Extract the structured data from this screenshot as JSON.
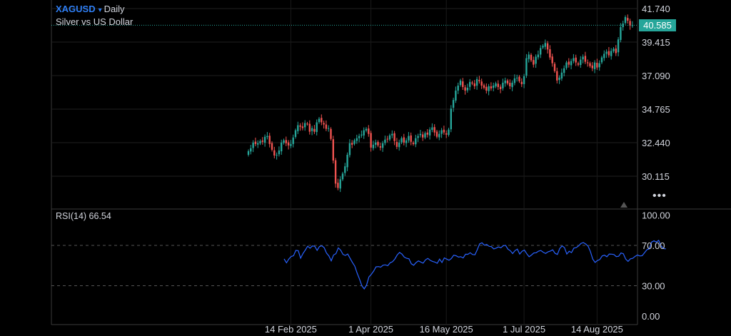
{
  "header": {
    "symbol": "XAGUSD",
    "caret": "▾",
    "timeframe": "Daily",
    "description": "Silver vs US Dollar",
    "last_price": "40.585"
  },
  "rsi_label": "RSI(14) 66.54",
  "colors": {
    "up": "#26a69a",
    "down": "#ef5350",
    "rsi": "#2962ff",
    "background": "#000000",
    "grid": "#1f1f1f"
  },
  "chart_data": [
    {
      "type": "candlestick",
      "title": "XAGUSD Daily",
      "ylim": [
        28.6,
        42.3
      ],
      "y_ticks": [
        "41.740",
        "39.415",
        "37.090",
        "34.765",
        "32.440",
        "30.115"
      ],
      "x_ticks": [
        "14 Feb 2025",
        "1 Apr 2025",
        "16 May 2025",
        "1 Jul 2025",
        "14 Aug 2025"
      ],
      "x_tick_index": [
        18,
        52,
        84,
        117,
        148
      ],
      "last_price": 40.585,
      "close": [
        31.85,
        32.05,
        32.45,
        32.35,
        32.4,
        32.55,
        32.5,
        32.85,
        32.9,
        32.35,
        31.95,
        31.55,
        31.6,
        31.9,
        32.45,
        32.6,
        32.4,
        32.25,
        32.35,
        32.8,
        33.3,
        33.65,
        33.55,
        33.45,
        33.8,
        33.75,
        33.2,
        33.45,
        33.2,
        33.85,
        34.1,
        33.85,
        33.7,
        33.4,
        33.45,
        32.7,
        31.2,
        29.6,
        29.3,
        29.9,
        30.3,
        30.8,
        31.6,
        32.4,
        32.3,
        32.6,
        32.75,
        32.9,
        33.0,
        33.3,
        33.4,
        33.05,
        32.1,
        32.3,
        32.45,
        32.25,
        32.1,
        32.4,
        32.65,
        32.7,
        32.95,
        33.05,
        32.55,
        32.15,
        32.45,
        32.75,
        32.45,
        32.6,
        32.9,
        32.5,
        32.35,
        32.75,
        32.9,
        33.05,
        32.8,
        33.1,
        33.0,
        33.35,
        33.5,
        33.15,
        32.85,
        33.05,
        33.3,
        33.15,
        33.0,
        33.35,
        34.8,
        35.4,
        36.05,
        36.4,
        36.75,
        36.3,
        36.05,
        36.25,
        36.65,
        36.55,
        36.35,
        36.85,
        36.7,
        36.4,
        36.25,
        36.05,
        36.35,
        36.2,
        36.4,
        36.55,
        36.3,
        36.15,
        36.6,
        36.75,
        36.55,
        36.35,
        36.6,
        36.9,
        36.95,
        36.7,
        36.5,
        37.05,
        38.3,
        38.55,
        38.15,
        37.85,
        38.4,
        38.55,
        39.0,
        39.15,
        39.35,
        38.9,
        38.35,
        37.95,
        37.4,
        36.75,
        36.95,
        37.3,
        37.6,
        38.0,
        37.85,
        38.1,
        38.3,
        38.0,
        37.85,
        38.2,
        38.4,
        38.05,
        37.95,
        37.75,
        37.6,
        38.0,
        37.65,
        37.95,
        38.35,
        38.6,
        38.75,
        38.5,
        38.8,
        38.95,
        38.65,
        39.6,
        40.45,
        40.7,
        41.15,
        40.9,
        40.55,
        40.585
      ],
      "y_range_note": "",
      "xlabel": "",
      "ylabel": ""
    },
    {
      "type": "line",
      "title": "RSI(14)",
      "series": [
        {
          "name": "RSI(14)",
          "values": [
            56.6,
            52.7,
            56.5,
            59.0,
            59.8,
            65.1,
            64.7,
            57.3,
            61.9,
            65.4,
            69.2,
            67.2,
            69.4,
            69.1,
            65.0,
            68.8,
            69.6,
            67.8,
            62.3,
            59.6,
            54.7,
            60.5,
            61.8,
            67.5,
            65.3,
            61.0,
            60.1,
            61.4,
            57.2,
            53.1,
            49.4,
            42.5,
            36.6,
            30.0,
            26.9,
            30.7,
            38.7,
            41.3,
            44.5,
            48.7,
            49.0,
            48.4,
            50.4,
            50.7,
            49.9,
            52.7,
            53.8,
            56.5,
            60.5,
            63.0,
            61.4,
            58.4,
            57.2,
            56.7,
            51.7,
            50.3,
            52.9,
            54.6,
            53.5,
            52.4,
            55.6,
            57.1,
            55.2,
            54.1,
            53.4,
            52.2,
            56.4,
            53.0,
            57.6,
            56.4,
            55.3,
            57.0,
            60.3,
            59.7,
            58.4,
            58.7,
            57.5,
            61.2,
            61.1,
            62.7,
            60.9,
            60.7,
            65.7,
            71.5,
            72.6,
            70.2,
            70.9,
            69.1,
            68.7,
            66.5,
            67.3,
            68.5,
            67.6,
            69.6,
            70.0,
            66.3,
            64.7,
            61.9,
            64.8,
            66.3,
            61.4,
            64.2,
            65.4,
            61.7,
            58.7,
            60.4,
            62.5,
            62.7,
            64.3,
            64.9,
            63.2,
            62.0,
            63.6,
            64.4,
            65.6,
            62.1,
            61.0,
            66.9,
            69.5,
            67.8,
            61.4,
            64.2,
            62.8,
            67.3,
            67.8,
            69.5,
            71.9,
            72.8,
            71.4,
            69.3,
            64.0,
            56.5,
            53.1,
            55.0,
            56.0,
            59.5,
            60.3,
            58.7,
            61.4,
            61.3,
            60.9,
            58.9,
            59.2,
            62.5,
            61.7,
            56.4,
            54.1,
            56.7,
            57.2,
            59.1,
            60.5,
            59.5,
            59.8,
            62.7,
            65.7,
            66.6,
            73.3,
            74.5,
            73.2,
            75.0,
            69.5,
            66.9,
            66.5
          ]
        }
      ],
      "ylim": [
        0,
        100
      ],
      "y_ticks": [
        "100.00",
        "70.00",
        "30.00",
        "0.00"
      ],
      "levels": [
        70,
        30
      ]
    }
  ]
}
